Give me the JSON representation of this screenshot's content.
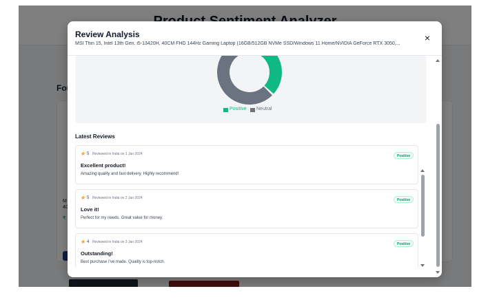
{
  "background": {
    "title": "Product Sentiment Analyzer",
    "found_prefix": "Fou"
  },
  "modal": {
    "title": "Review Analysis",
    "subtitle": "MSI Thin 15, Intel 13th Gen. i5-13420H, 40CM FHD 144Hz Gaming Laptop (16GB/512GB NVMe SSD/Windows 11 Home/NVIDIA GeForce RTX 3050,...",
    "close_label": "×"
  },
  "chart_data": {
    "type": "pie",
    "categories": [
      "Positive",
      "Neutral"
    ],
    "values": [
      40,
      60
    ],
    "colors": [
      "#10b981",
      "#6b7280"
    ],
    "legend_position": "bottom",
    "donut": true
  },
  "legend": [
    {
      "label": "Positive",
      "color": "#10b981"
    },
    {
      "label": "Neutral",
      "color": "#6b7280"
    }
  ],
  "latest_reviews_title": "Latest Reviews",
  "reviews": [
    {
      "rating": "5",
      "meta": "Reviewed in India on 1 Jan 2024",
      "title": "Excellent product!",
      "body": "Amazing quality and fast delivery. Highly recommend!",
      "badge": "Positive"
    },
    {
      "rating": "5",
      "meta": "Reviewed in India on 2 Jan 2024",
      "title": "Love it!",
      "body": "Perfect for my needs. Great value for money.",
      "badge": "Positive"
    },
    {
      "rating": "4",
      "meta": "Reviewed in India on 3 Jan 2024",
      "title": "Outstanding!",
      "body": "Best purchase I've made. Quality is top-notch.",
      "badge": "Positive"
    }
  ],
  "colors": {
    "accent": "#10b981",
    "neutral": "#6b7280",
    "star": "#f59e0b"
  }
}
